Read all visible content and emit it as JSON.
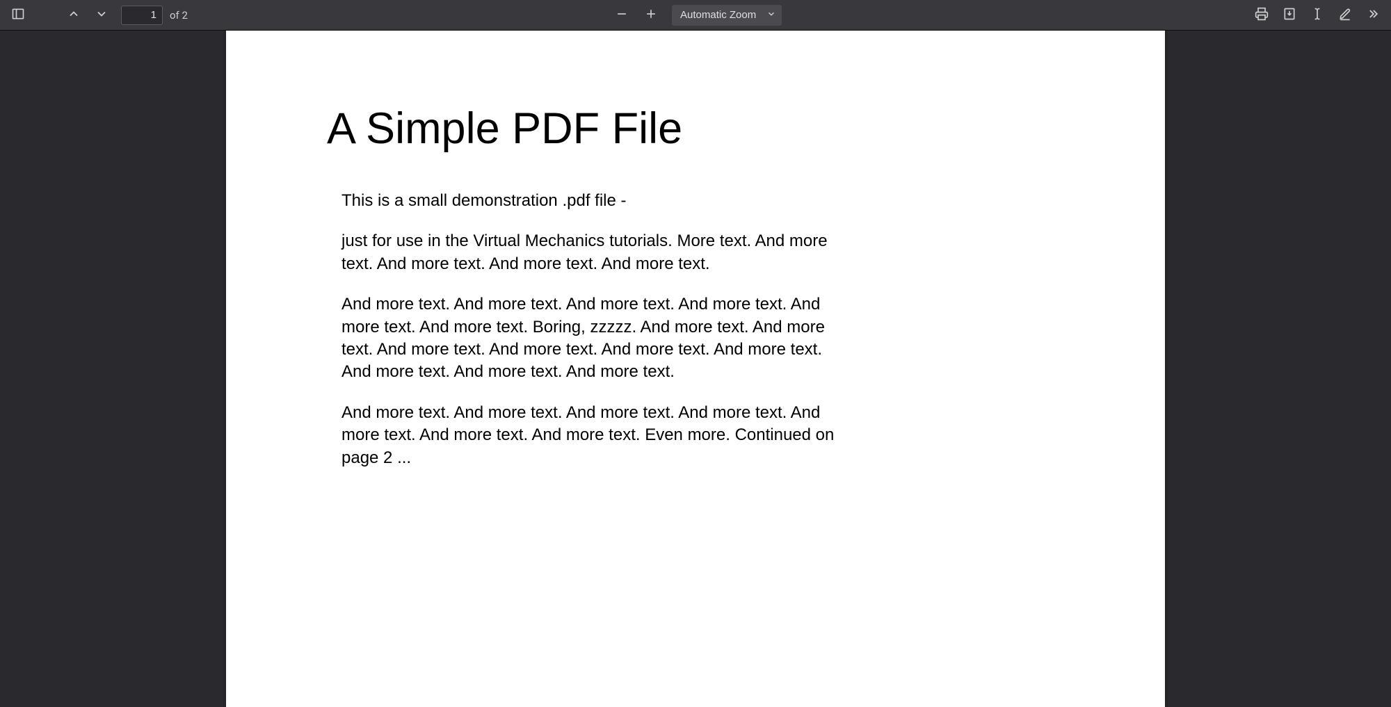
{
  "toolbar": {
    "page_input_value": "1",
    "page_count_label": "of 2",
    "zoom_selected": "Automatic Zoom"
  },
  "document": {
    "title": "A Simple PDF File",
    "paragraphs": [
      "This is a small demonstration .pdf file -",
      "just for use in the Virtual Mechanics tutorials. More text. And more text. And more text. And more text. And more text.",
      "And more text. And more text. And more text. And more text. And more text. And more text. Boring, zzzzz. And more text. And more text. And more text. And more text. And more text. And more text. And more text. And more text. And more text.",
      "And more text. And more text. And more text. And more text. And more text. And more text. And more text. Even more. Continued on page 2 ..."
    ]
  }
}
